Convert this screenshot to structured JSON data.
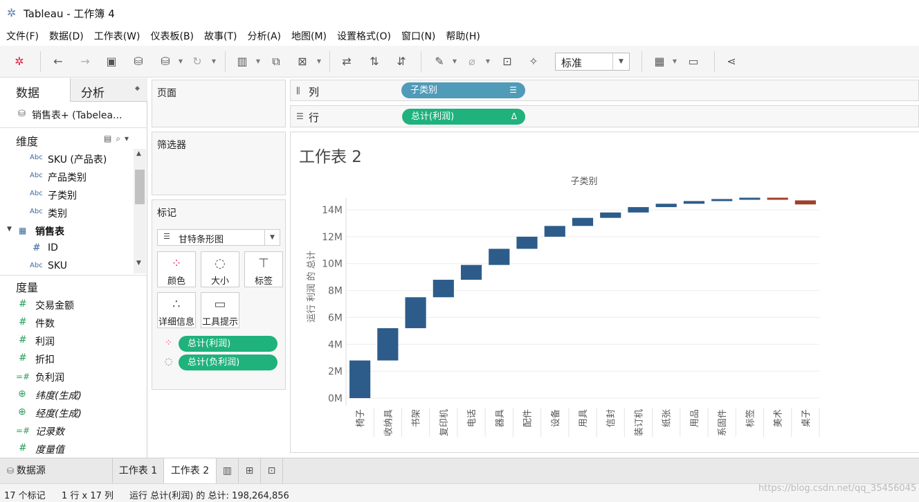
{
  "window": {
    "title": "Tableau - 工作簿 4"
  },
  "menu": [
    "文件(F)",
    "数据(D)",
    "工作表(W)",
    "仪表板(B)",
    "故事(T)",
    "分析(A)",
    "地图(M)",
    "设置格式(O)",
    "窗口(N)",
    "帮助(H)"
  ],
  "toolbar": {
    "zoom_value": "标准"
  },
  "left_pane": {
    "tab_data": "数据",
    "tab_analysis": "分析",
    "datasource": "销售表+ (Tabelea...",
    "dimensions_label": "维度",
    "dimensions": [
      {
        "type": "Abc",
        "label": "SKU (产品表)"
      },
      {
        "type": "Abc",
        "label": "产品类别"
      },
      {
        "type": "Abc",
        "label": "子类别"
      },
      {
        "type": "Abc",
        "label": "类别"
      },
      {
        "type": "table",
        "label": "销售表"
      },
      {
        "type": "#",
        "label": "ID"
      },
      {
        "type": "Abc",
        "label": "SKU"
      }
    ],
    "measures_label": "度量",
    "measures": [
      {
        "type": "#",
        "label": "交易金额"
      },
      {
        "type": "#",
        "label": "件数"
      },
      {
        "type": "#",
        "label": "利润"
      },
      {
        "type": "#",
        "label": "折扣"
      },
      {
        "type": "=#",
        "label": "负利润"
      },
      {
        "type": "globe",
        "label": "纬度(生成)"
      },
      {
        "type": "globe",
        "label": "经度(生成)"
      },
      {
        "type": "=#",
        "label": "记录数"
      },
      {
        "type": "#",
        "label": "度量值"
      }
    ]
  },
  "cards": {
    "pages": "页面",
    "filters": "筛选器",
    "marks": "标记",
    "mark_type": "甘特条形图",
    "mark_buttons": [
      "颜色",
      "大小",
      "标签",
      "详细信息",
      "工具提示"
    ],
    "mark_pills": [
      "总计(利润)",
      "总计(负利润)"
    ]
  },
  "shelves": {
    "columns_label": "列",
    "columns_pill": "子类别",
    "rows_label": "行",
    "rows_pill": "总计(利润)"
  },
  "viz": {
    "sheet_title": "工作表 2",
    "header": "子类别",
    "ylabel": "运行 利润 的 总计"
  },
  "chart_data": {
    "type": "bar",
    "subtype": "waterfall",
    "title": "工作表 2",
    "xlabel": "子类别",
    "ylabel": "运行 利润 的 总计",
    "yticks": [
      "0M",
      "2M",
      "4M",
      "6M",
      "8M",
      "10M",
      "12M",
      "14M"
    ],
    "ylim": [
      -0.5,
      15
    ],
    "categories": [
      "椅子",
      "收纳具",
      "书架",
      "复印机",
      "电话",
      "器具",
      "配件",
      "设备",
      "用具",
      "信封",
      "装订机",
      "纸张",
      "用品",
      "系固件",
      "标签",
      "美术",
      "桌子"
    ],
    "start": [
      0,
      2.8,
      5.2,
      7.5,
      8.8,
      9.9,
      11.1,
      12.0,
      12.8,
      13.4,
      13.8,
      14.2,
      14.45,
      14.65,
      14.8,
      14.9,
      14.7
    ],
    "end": [
      2.8,
      5.2,
      7.5,
      8.8,
      9.9,
      11.1,
      12.0,
      12.8,
      13.4,
      13.8,
      14.2,
      14.45,
      14.65,
      14.8,
      14.9,
      14.85,
      14.4
    ],
    "colors": {
      "positive": "#2d5c8a",
      "negative": "#a0402a"
    },
    "grid": true
  },
  "tabs": {
    "datasource": "数据源",
    "sheets": [
      "工作表 1",
      "工作表 2"
    ]
  },
  "status": {
    "marks": "17 个标记",
    "dims": "1 行 x 17 列",
    "sum": "运行 总计(利润) 的 总计: 198,264,856"
  },
  "watermark": "https://blog.csdn.net/qq_35456045"
}
